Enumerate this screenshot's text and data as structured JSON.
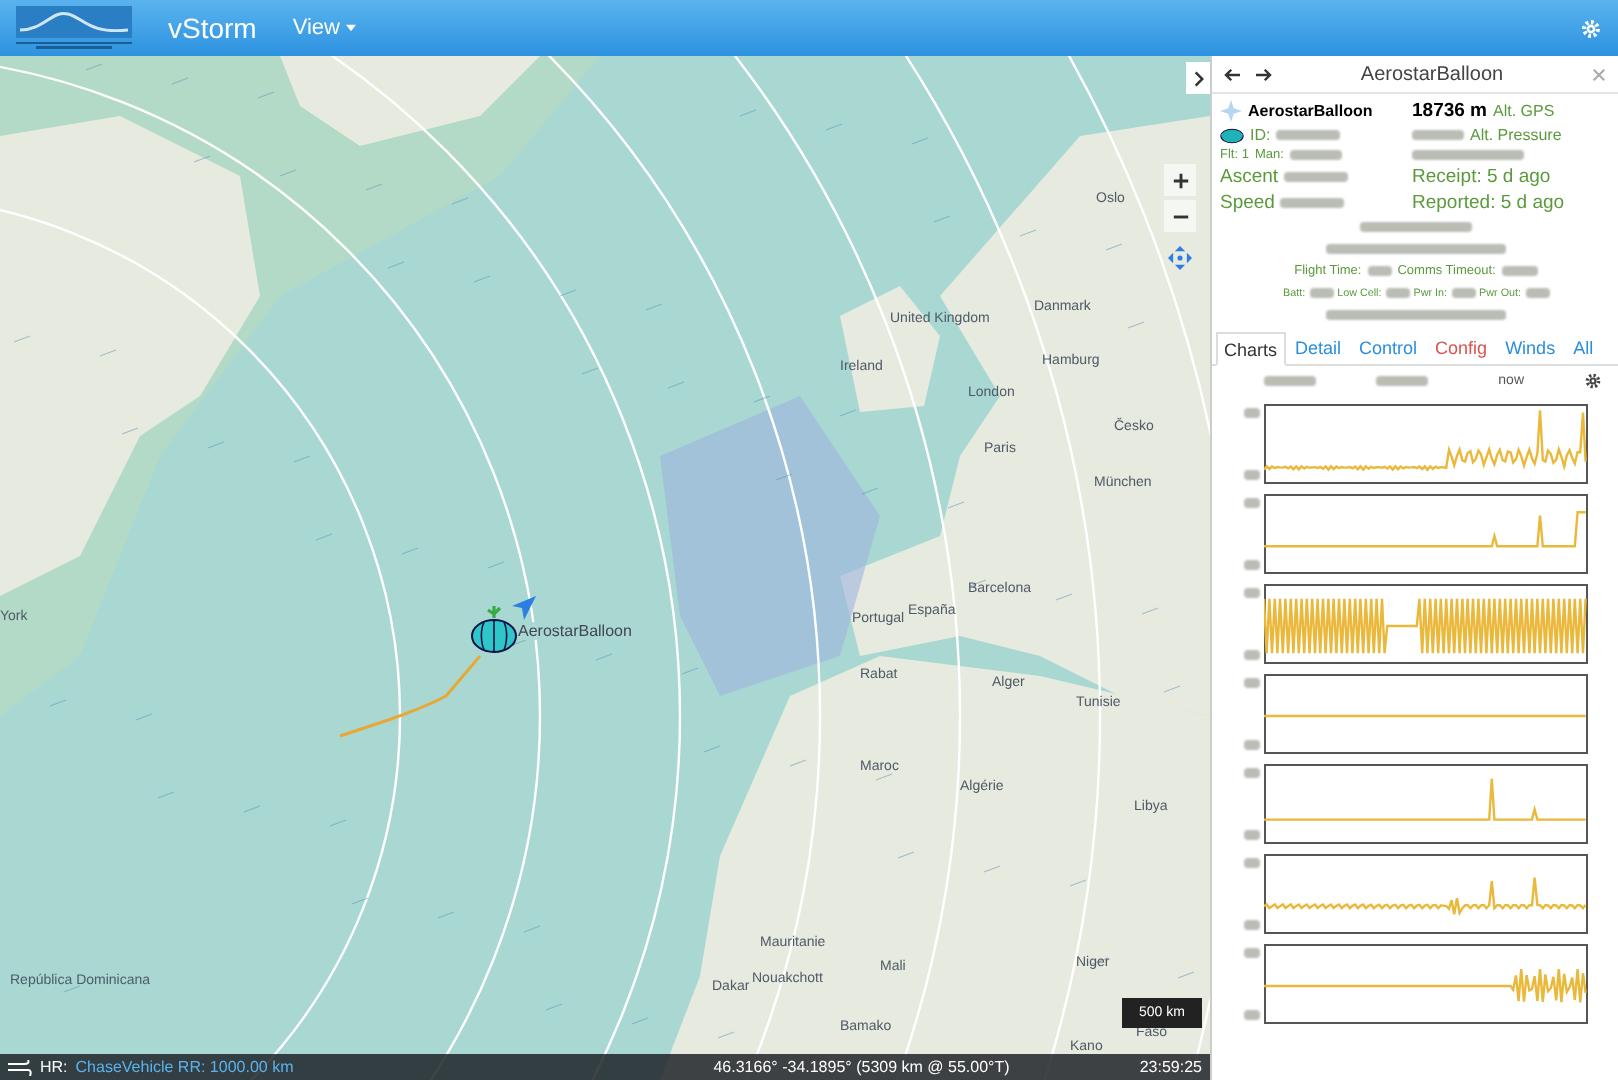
{
  "header": {
    "app_title": "vStorm",
    "menu": "View"
  },
  "map": {
    "place_labels": [
      "Oslo",
      "Danmark",
      "United Kingdom",
      "Ireland",
      "London",
      "Hamburg",
      "Česko",
      "Paris",
      "München",
      "Barcelona",
      "España",
      "Portugal",
      "Rabat",
      "Alger",
      "Tunisie",
      "Maroc",
      "Algérie",
      "Libya",
      "Mauritanie",
      "Nouakchott",
      "Mali",
      "Niger",
      "Dakar",
      "Bamako",
      "Faso",
      "Kano",
      "York",
      "República Dominicana"
    ],
    "marker_label": "AerostarBalloon",
    "scale": "500 km"
  },
  "panel": {
    "title": "AerostarBalloon",
    "name": "AerostarBalloon",
    "altitude": "18736 m",
    "alt_gps": "Alt. GPS",
    "id_label": "ID:",
    "alt_pressure": "Alt. Pressure",
    "flt": "Flt: 1",
    "man": "Man:",
    "ascent": "Ascent",
    "receipt": "Receipt: 5 d ago",
    "speed": "Speed",
    "reported": "Reported: 5 d ago",
    "flight_time": "Flight Time:",
    "comms_timeout": "Comms Timeout:",
    "batt": "Batt:",
    "low_cell": "Low Cell:",
    "pwr_in": "Pwr In:",
    "pwr_out": "Pwr Out:"
  },
  "tabs": [
    {
      "label": "Charts",
      "selected": true,
      "color": "#333333"
    },
    {
      "label": "Detail",
      "selected": false,
      "color": "#2a8ee0"
    },
    {
      "label": "Control",
      "selected": false,
      "color": "#2a8ee0"
    },
    {
      "label": "Config",
      "selected": false,
      "color": "#d9534f"
    },
    {
      "label": "Winds",
      "selected": false,
      "color": "#2a8ee0"
    },
    {
      "label": "All",
      "selected": false,
      "color": "#2a8ee0"
    }
  ],
  "charts": {
    "time_end": "now"
  },
  "status_bar": {
    "hr": "HR:",
    "link": "ChaseVehicle RR: 1000.00 km",
    "position": "46.3166° -34.1895° (5309 km @ 55.00°T)",
    "time": "23:59:25"
  }
}
